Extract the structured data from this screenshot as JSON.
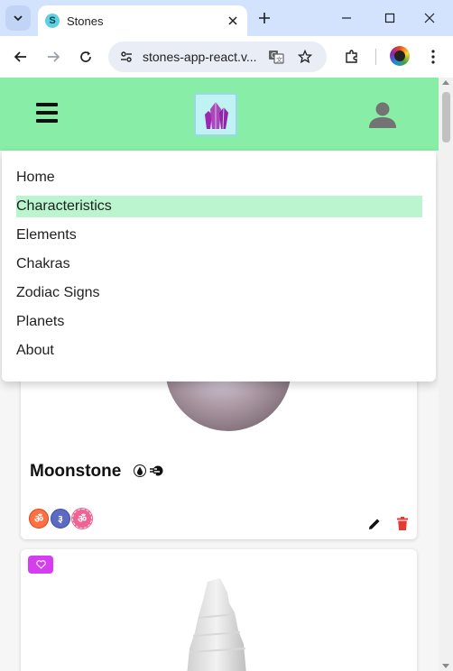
{
  "browser": {
    "tab_title": "Stones",
    "tab_favicon_letter": "S",
    "url": "stones-app-react.v..."
  },
  "app": {
    "logo_name": "crystal-logo",
    "menu": [
      {
        "label": "Home",
        "active": false
      },
      {
        "label": "Characteristics",
        "active": true
      },
      {
        "label": "Elements",
        "active": false
      },
      {
        "label": "Chakras",
        "active": false
      },
      {
        "label": "Zodiac Signs",
        "active": false
      },
      {
        "label": "Planets",
        "active": false
      },
      {
        "label": "About",
        "active": false
      }
    ],
    "cards": [
      {
        "name": "Moonstone",
        "elements": [
          "water-drop-icon",
          "wind-icon"
        ],
        "chakras": [
          {
            "glyph": "ॐ",
            "color": "#ff7043"
          },
          {
            "glyph": "३",
            "color": "#5c6bc0"
          },
          {
            "glyph": "ॐ",
            "color": "#f06292"
          }
        ]
      },
      {
        "name": "",
        "favorite": true
      }
    ]
  },
  "colors": {
    "appbar": "#88eda6",
    "menu_active": "#baf5cf",
    "delete": "#e53935",
    "favorite": "#d63cf0"
  }
}
